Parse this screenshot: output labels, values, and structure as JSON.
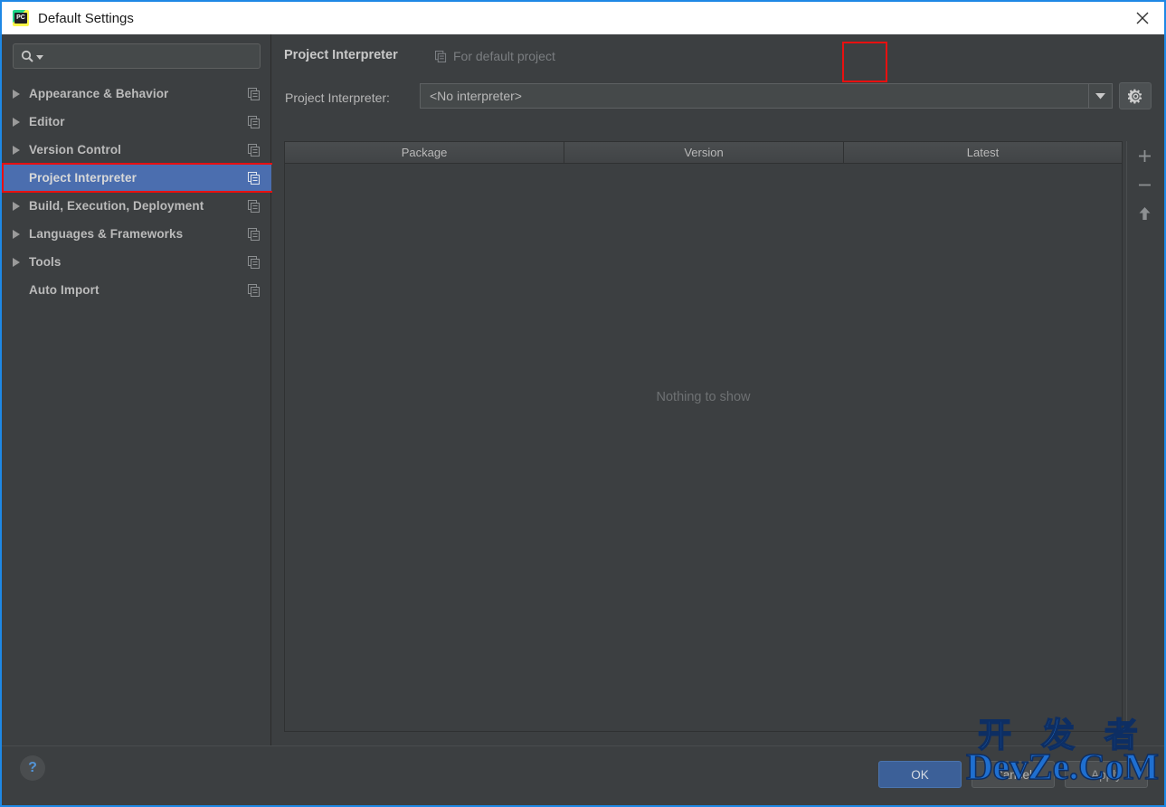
{
  "window": {
    "title": "Default Settings",
    "app_icon": "pycharm-icon",
    "close_icon": "close-icon",
    "accent_border": "#1e88e5"
  },
  "search": {
    "value": "",
    "placeholder": "",
    "icon": "search-icon",
    "dropdown_icon": "caret-down-icon"
  },
  "sidebar": {
    "items": [
      {
        "label": "Appearance & Behavior",
        "expandable": true,
        "selected": false,
        "copy_icon": "copy-icon"
      },
      {
        "label": "Editor",
        "expandable": true,
        "selected": false,
        "copy_icon": "copy-icon"
      },
      {
        "label": "Version Control",
        "expandable": true,
        "selected": false,
        "copy_icon": "copy-icon"
      },
      {
        "label": "Project Interpreter",
        "expandable": false,
        "selected": true,
        "copy_icon": "copy-icon"
      },
      {
        "label": "Build, Execution, Deployment",
        "expandable": true,
        "selected": false,
        "copy_icon": "copy-icon"
      },
      {
        "label": "Languages & Frameworks",
        "expandable": true,
        "selected": false,
        "copy_icon": "copy-icon"
      },
      {
        "label": "Tools",
        "expandable": true,
        "selected": false,
        "copy_icon": "copy-icon"
      },
      {
        "label": "Auto Import",
        "expandable": false,
        "selected": false,
        "copy_icon": "copy-icon"
      }
    ],
    "selected_bg": "#4b6eaf"
  },
  "main": {
    "panel_title": "Project Interpreter",
    "panel_subtitle": "For default project",
    "subtitle_icon": "copy-icon",
    "interpreter_label": "Project Interpreter:",
    "interpreter_value": "<No interpreter>",
    "gear_icon": "gear-icon",
    "combo_arrow_icon": "caret-down-icon"
  },
  "table": {
    "columns": [
      "Package",
      "Version",
      "Latest"
    ],
    "rows": [],
    "empty_message": "Nothing to show"
  },
  "side_toolbar": {
    "buttons": [
      {
        "name": "add-package-button",
        "icon": "plus-icon"
      },
      {
        "name": "remove-package-button",
        "icon": "minus-icon"
      },
      {
        "name": "upgrade-package-button",
        "icon": "arrow-up-icon"
      }
    ]
  },
  "footer": {
    "help_label": "?",
    "ok_label": "OK",
    "cancel_label": "Cancel",
    "apply_label": "Apply",
    "ok_color": "#3c6098"
  },
  "watermark": {
    "line1": "开 发 者",
    "line2": "DevZe.CoM",
    "color": "#1f6fd0"
  },
  "annotations": [
    {
      "name": "annotation-box-project-interpreter",
      "color": "#e81010"
    },
    {
      "name": "annotation-box-gear-button",
      "color": "#e81010"
    }
  ]
}
